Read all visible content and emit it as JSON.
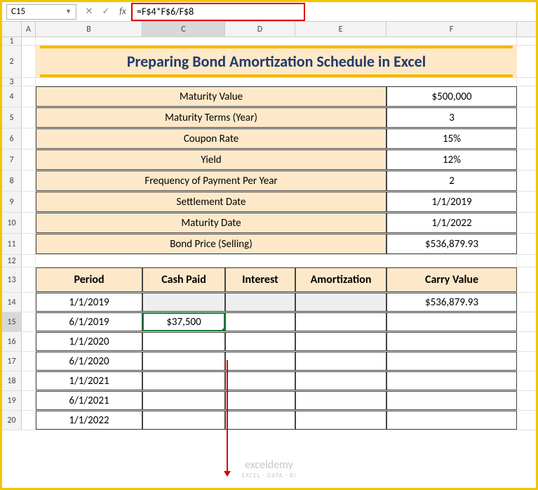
{
  "formula_bar": {
    "name_box": "C15",
    "formula": "=F$4*F$6/F$8"
  },
  "columns": [
    "A",
    "B",
    "C",
    "D",
    "E",
    "F"
  ],
  "rows": [
    "1",
    "2",
    "3",
    "4",
    "5",
    "6",
    "7",
    "8",
    "9",
    "10",
    "11",
    "12",
    "13",
    "14",
    "15",
    "16",
    "17",
    "18",
    "19",
    "20"
  ],
  "title": "Preparing Bond Amortization Schedule in Excel",
  "params": [
    {
      "label": "Maturity Value",
      "value": "$500,000"
    },
    {
      "label": "Maturity Terms (Year)",
      "value": "3"
    },
    {
      "label": "Coupon Rate",
      "value": "15%"
    },
    {
      "label": "Yield",
      "value": "12%"
    },
    {
      "label": "Frequency of Payment Per Year",
      "value": "2"
    },
    {
      "label": "Settlement Date",
      "value": "1/1/2019"
    },
    {
      "label": "Maturity Date",
      "value": "1/1/2022"
    },
    {
      "label": "Bond Price (Selling)",
      "value": "$536,879.93"
    }
  ],
  "table": {
    "headers": [
      "Period",
      "Cash Paid",
      "Interest",
      "Amortization",
      "Carry Value"
    ],
    "rows": [
      {
        "period": "1/1/2019",
        "cash": "",
        "interest": "",
        "amort": "",
        "carry": "$536,879.93",
        "shade": true
      },
      {
        "period": "6/1/2019",
        "cash": "$37,500",
        "interest": "",
        "amort": "",
        "carry": "",
        "selected": true
      },
      {
        "period": "1/1/2020",
        "cash": "",
        "interest": "",
        "amort": "",
        "carry": ""
      },
      {
        "period": "6/1/2020",
        "cash": "",
        "interest": "",
        "amort": "",
        "carry": ""
      },
      {
        "period": "1/1/2021",
        "cash": "",
        "interest": "",
        "amort": "",
        "carry": ""
      },
      {
        "period": "6/1/2021",
        "cash": "",
        "interest": "",
        "amort": "",
        "carry": ""
      },
      {
        "period": "1/1/2022",
        "cash": "",
        "interest": "",
        "amort": "",
        "carry": ""
      }
    ]
  },
  "watermark": {
    "main": "exceldemy",
    "sub": "EXCEL · DATA · BI"
  },
  "chart_data": {
    "type": "table",
    "title": "Preparing Bond Amortization Schedule in Excel",
    "parameters": {
      "Maturity Value": 500000,
      "Maturity Terms (Year)": 3,
      "Coupon Rate": 0.15,
      "Yield": 0.12,
      "Frequency of Payment Per Year": 2,
      "Settlement Date": "1/1/2019",
      "Maturity Date": "1/1/2022",
      "Bond Price (Selling)": 536879.93
    },
    "schedule_columns": [
      "Period",
      "Cash Paid",
      "Interest",
      "Amortization",
      "Carry Value"
    ],
    "schedule_data": [
      [
        "1/1/2019",
        null,
        null,
        null,
        536879.93
      ],
      [
        "6/1/2019",
        37500,
        null,
        null,
        null
      ],
      [
        "1/1/2020",
        null,
        null,
        null,
        null
      ],
      [
        "6/1/2020",
        null,
        null,
        null,
        null
      ],
      [
        "1/1/2021",
        null,
        null,
        null,
        null
      ],
      [
        "6/1/2021",
        null,
        null,
        null,
        null
      ],
      [
        "1/1/2022",
        null,
        null,
        null,
        null
      ]
    ],
    "active_cell_formula": "=F$4*F$6/F$8"
  }
}
